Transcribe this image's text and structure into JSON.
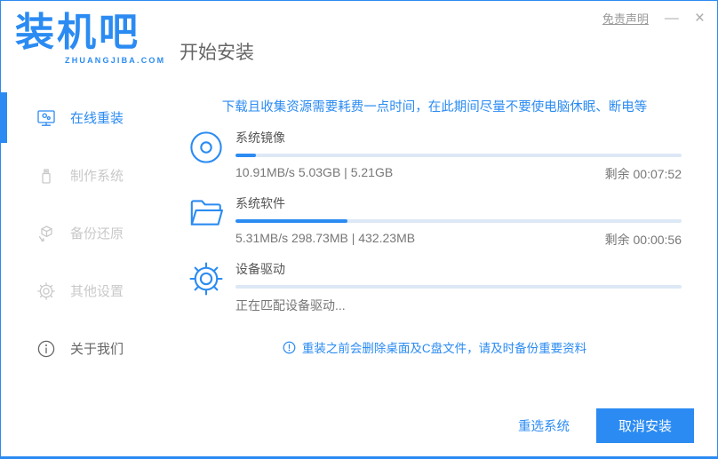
{
  "colors": {
    "accent": "#2b8bf2",
    "track": "#dde8f6"
  },
  "window": {
    "logo_title": "装机吧",
    "logo_subtitle": "ZHUANGJIBA.COM",
    "disclaimer": "免责声明",
    "minimize_label": "—",
    "close_label": "×"
  },
  "header": {
    "title": "开始安装"
  },
  "sidebar": {
    "items": [
      {
        "label": "在线重装",
        "icon": "monitor-reinstall-icon",
        "active": true
      },
      {
        "label": "制作系统",
        "icon": "usb-drive-icon",
        "active": false
      },
      {
        "label": "备份还原",
        "icon": "backup-box-icon",
        "active": false
      },
      {
        "label": "其他设置",
        "icon": "gear-icon",
        "active": false
      },
      {
        "label": "关于我们",
        "icon": "info-icon",
        "active": false
      }
    ]
  },
  "main": {
    "notice": "下载且收集资源需要耗费一点时间，在此期间尽量不要使电脑休眠、断电等",
    "tasks": [
      {
        "name": "系统镜像",
        "icon": "disc-icon",
        "progress_pct": 4.5,
        "stats": "10.91MB/s 5.03GB | 5.21GB",
        "remaining": "剩余 00:07:52"
      },
      {
        "name": "系统软件",
        "icon": "folder-icon",
        "progress_pct": 25,
        "stats": "5.31MB/s 298.73MB | 432.23MB",
        "remaining": "剩余 00:00:56"
      },
      {
        "name": "设备驱动",
        "icon": "gear-icon",
        "progress_pct": 0,
        "stats": "正在匹配设备驱动...",
        "remaining": ""
      }
    ],
    "warning": "重装之前会删除桌面及C盘文件，请及时备份重要资料"
  },
  "footer": {
    "reselect_label": "重选系统",
    "cancel_label": "取消安装"
  }
}
